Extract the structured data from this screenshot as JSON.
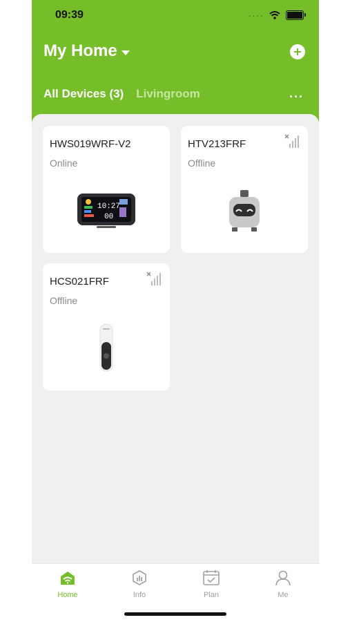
{
  "status_bar": {
    "time": "09:39",
    "dots": "····"
  },
  "header": {
    "title": "My Home",
    "tabs": [
      {
        "label": "All Devices (3)",
        "active": true
      },
      {
        "label": "Livingroom",
        "active": false
      }
    ],
    "more": "···"
  },
  "devices": [
    {
      "name": "HWS019WRF-V2",
      "status": "Online",
      "icon": "weather-station-image"
    },
    {
      "name": "HTV213FRF",
      "status": "Offline",
      "icon": "radiator-valve-image"
    },
    {
      "name": "HCS021FRF",
      "status": "Offline",
      "icon": "sensor-image"
    }
  ],
  "weather_display": {
    "time": "10:27",
    "temp": "00"
  },
  "nav": [
    {
      "label": "Home",
      "active": true
    },
    {
      "label": "Info",
      "active": false
    },
    {
      "label": "Plan",
      "active": false
    },
    {
      "label": "Me",
      "active": false
    }
  ],
  "colors": {
    "accent": "#76bd2a",
    "inactive": "#a0a0a0",
    "background": "#f0f0f0"
  }
}
